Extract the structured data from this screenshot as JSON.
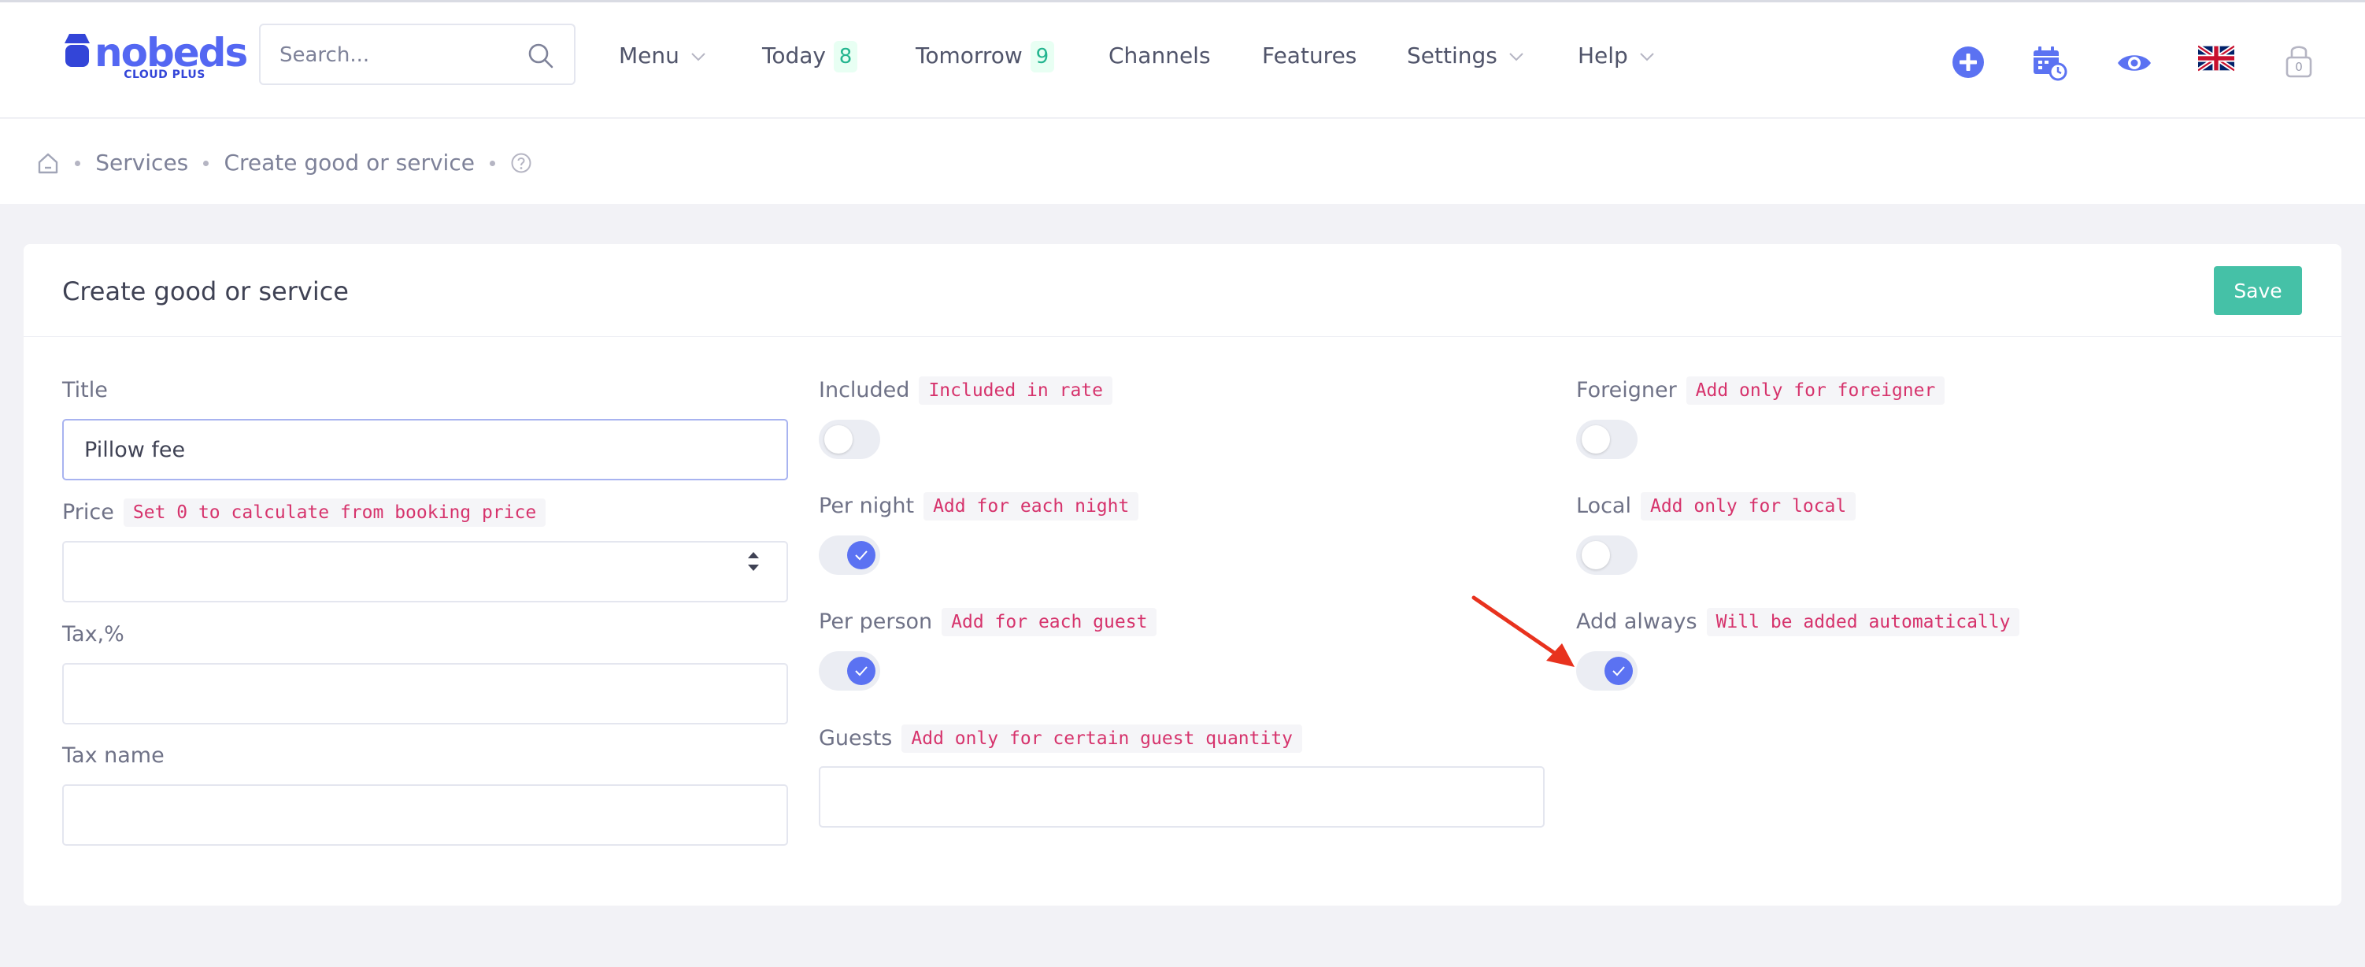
{
  "brand": {
    "name": "nobeds",
    "sub": "CLOUD PLUS",
    "color": "#5467f2"
  },
  "search": {
    "placeholder": "Search...",
    "value": ""
  },
  "nav": {
    "menu": "Menu",
    "today": "Today",
    "today_count": "8",
    "tomorrow": "Tomorrow",
    "tomorrow_count": "9",
    "channels": "Channels",
    "features": "Features",
    "settings": "Settings",
    "help": "Help"
  },
  "header_icons": [
    "plus-circle-icon",
    "calendar-clock-icon",
    "eye-icon",
    "uk-flag-icon",
    "lock-icon"
  ],
  "lock_count": "0",
  "breadcrumb": {
    "items": [
      "Services",
      "Create good or service"
    ]
  },
  "card": {
    "title": "Create good or service",
    "save_label": "Save"
  },
  "form": {
    "title": {
      "label": "Title",
      "value": "Pillow fee"
    },
    "price": {
      "label": "Price",
      "hint": "Set 0 to calculate from booking price",
      "value": ""
    },
    "tax": {
      "label": "Tax,%",
      "value": ""
    },
    "tax_name": {
      "label": "Tax name",
      "value": ""
    },
    "included": {
      "label": "Included",
      "hint": "Included in rate",
      "checked": false
    },
    "per_night": {
      "label": "Per night",
      "hint": "Add for each night",
      "checked": true
    },
    "per_person": {
      "label": "Per person",
      "hint": "Add for each guest",
      "checked": true
    },
    "guests": {
      "label": "Guests",
      "hint": "Add only for certain guest quantity",
      "value": ""
    },
    "foreigner": {
      "label": "Foreigner",
      "hint": "Add only for foreigner",
      "checked": false
    },
    "local": {
      "label": "Local",
      "hint": "Add only for local",
      "checked": false
    },
    "add_always": {
      "label": "Add always",
      "hint": "Will be added automatically",
      "checked": true
    }
  },
  "colors": {
    "accent": "#5b72f2",
    "save": "#45c1a7",
    "hint_text": "#d6336c",
    "badge_text": "#24b58f",
    "annotation_arrow": "#e8321e"
  }
}
